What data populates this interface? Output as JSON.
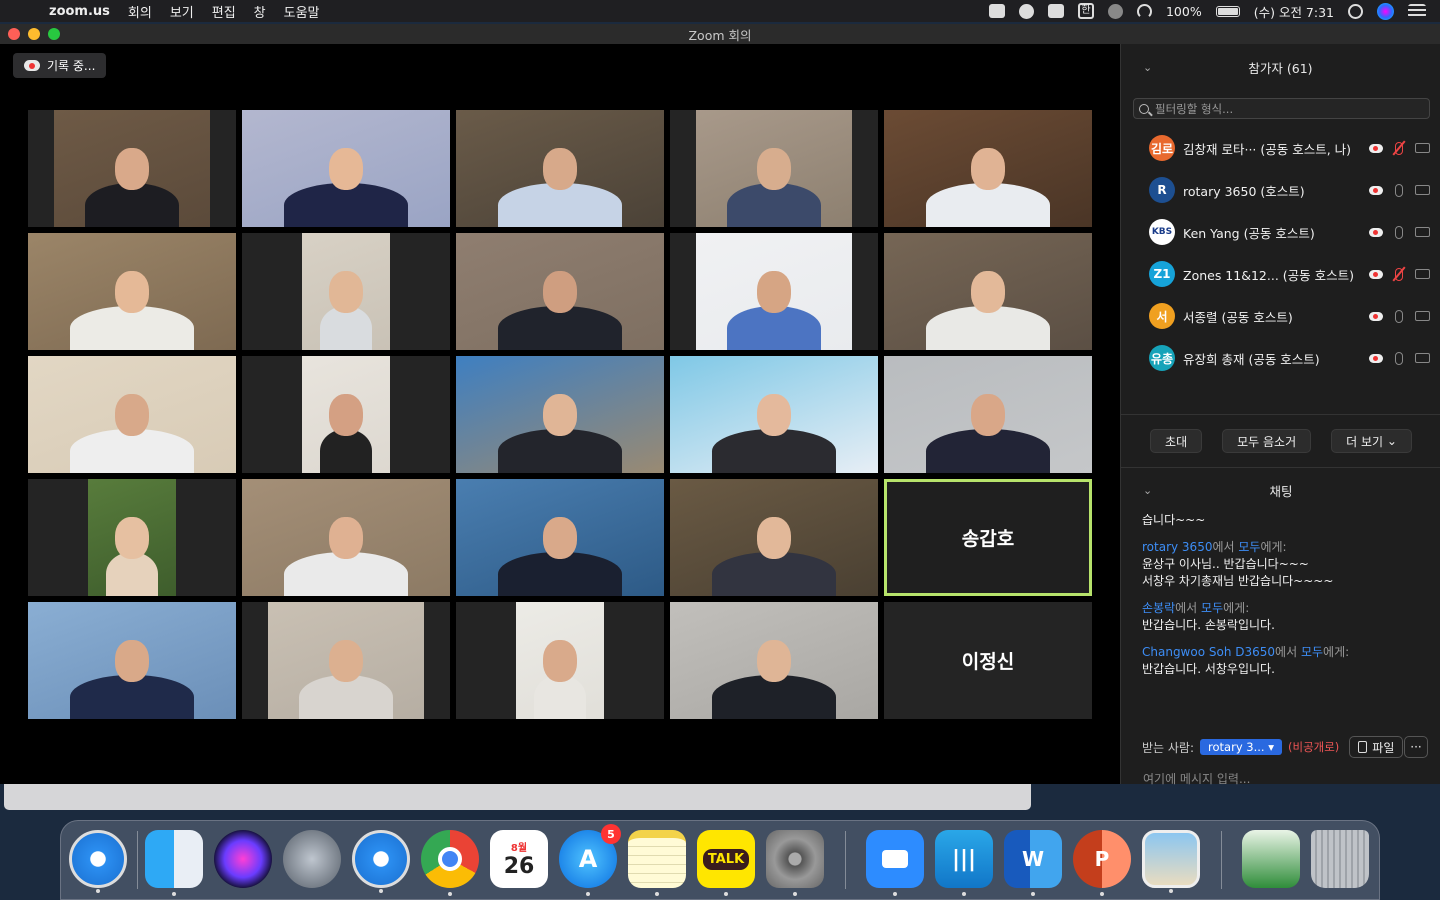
{
  "menubar": {
    "app": "zoom.us",
    "items": [
      "회의",
      "보기",
      "편집",
      "창",
      "도움말"
    ],
    "battery": "100%",
    "clock": "(수) 오전 7:31",
    "input_method": "한"
  },
  "window": {
    "title": "Zoom 회의"
  },
  "recording": {
    "label": "기록 중..."
  },
  "tiles": [
    {
      "bg": "#5b4a3a",
      "vid": "#6e5a46",
      "skin": "#d9a98a",
      "shirt": "#1d1d22"
    },
    {
      "bg": "#9aa4c4",
      "vid": "#b3b7cf",
      "skin": "#e6b896",
      "shirt": "#1f2547"
    },
    {
      "bg": "#4b4237",
      "vid": "#6a5b49",
      "skin": "#d7a98a",
      "shirt": "#c6d3e6"
    },
    {
      "bg": "#8d8070",
      "vid": "#a8998a",
      "skin": "#d7ad8e",
      "shirt": "#3c4a6a"
    },
    {
      "bg": "#4a3526",
      "vid": "#6b4b34",
      "skin": "#e0b394",
      "shirt": "#e9ecf0"
    },
    {
      "bg": "#7e6a52",
      "vid": "#9b8568",
      "skin": "#e5b997",
      "shirt": "#ecebe6"
    },
    {
      "bg": "#c9c2b6",
      "vid": "#d8d1c5",
      "skin": "#e1b796",
      "shirt": "#d9dcdf"
    },
    {
      "bg": "#7e6f61",
      "vid": "#8f7e70",
      "skin": "#cf9e80",
      "shirt": "#20232c"
    },
    {
      "bg": "#e9ebee",
      "vid": "#f0f1f3",
      "skin": "#d6a584",
      "shirt": "#4c74c2"
    },
    {
      "bg": "#5b4f44",
      "vid": "#766655",
      "skin": "#e3b999",
      "shirt": "#e9e9e6"
    },
    {
      "bg": "#d8cbb6",
      "vid": "#e2d7c4",
      "skin": "#d8a98a",
      "shirt": "#eeeeee"
    },
    {
      "bg": "#ddd8d0",
      "vid": "#e8e4dd",
      "skin": "#d4a083",
      "shirt": "#222"
    },
    {
      "bg": "#9a8a72",
      "vid": "#3e7fc1",
      "skin": "#e0b596",
      "shirt": "#23252c"
    },
    {
      "bg": "#e7eef5",
      "vid": "#7fc8e6",
      "skin": "#e4b99c",
      "shirt": "#2b2b30"
    },
    {
      "bg": "#c5c7c9",
      "vid": "#b9bcbf",
      "skin": "#d9a788",
      "shirt": "#222436"
    },
    {
      "bg": "#3e5d2c",
      "vid": "#587c3c",
      "skin": "#e6c0a1",
      "shirt": "#e6d2bc"
    },
    {
      "bg": "#8c7a64",
      "vid": "#a48f77",
      "skin": "#dfb192",
      "shirt": "#eaeaea"
    },
    {
      "bg": "#2d5a86",
      "vid": "#4a7eb0",
      "skin": "#d9a98a",
      "shirt": "#1a2030"
    },
    {
      "bg": "#4a4032",
      "vid": "#6a5a44",
      "skin": "#e2b899",
      "shirt": "#323440"
    },
    {
      "bg": "#1f1f1f",
      "vid": "",
      "skin": "",
      "shirt": ""
    },
    {
      "bg": "#6b8fb8",
      "vid": "#8aaed3",
      "skin": "#d9a989",
      "shirt": "#1f2a4a"
    },
    {
      "bg": "#b6aea3",
      "vid": "#c9c0b3",
      "skin": "#dcb090",
      "shirt": "#d8d4cf"
    },
    {
      "bg": "#e1dfd9",
      "vid": "#ecebe6",
      "skin": "#d9aa8b",
      "shirt": "#e8e6e1"
    },
    {
      "bg": "#a9a7a3",
      "vid": "#c1bfbb",
      "skin": "#dfb596",
      "shirt": "#1e2128"
    },
    {
      "bg": "#242424",
      "vid": "",
      "skin": "",
      "shirt": ""
    }
  ],
  "tile_names": {
    "t19": "송갑호",
    "t24": "이정신"
  },
  "participants": {
    "title": "참가자 (61)",
    "filter_placeholder": "필터링할 형식...",
    "list": [
      {
        "avatar": "김로",
        "avatar_color": "#e8692e",
        "name": "김창재 로타···  (공동 호스트, 나)",
        "mic_muted": true
      },
      {
        "avatar": "R",
        "avatar_color": "#1d4f91",
        "name": "rotary 3650 (호스트)",
        "mic_muted": false
      },
      {
        "avatar": "KBS",
        "avatar_color": "#ffffff",
        "name": "Ken Yang (공동 호스트)",
        "mic_muted": false
      },
      {
        "avatar": "Z1",
        "avatar_color": "#16a3d9",
        "name": "Zones 11&12...  (공동 호스트)",
        "mic_muted": true
      },
      {
        "avatar": "서",
        "avatar_color": "#f0a020",
        "name": "서종렬 (공동 호스트)",
        "mic_muted": false
      },
      {
        "avatar": "유총",
        "avatar_color": "#16a3b9",
        "name": "유장희 총재 (공동 호스트)",
        "mic_muted": false
      }
    ],
    "buttons": {
      "invite": "초대",
      "mute_all": "모두 음소거",
      "more": "더 보기"
    }
  },
  "chat": {
    "title": "채팅",
    "partial_text": "습니다~~~",
    "messages": [
      {
        "from": "rotary 3650",
        "from_suffix": "에서 ",
        "to": "모두",
        "to_suffix": "에게:",
        "lines": [
          "윤상구 이사님.. 반갑습니다~~~",
          "서창우 차기총재님 반갑습니다~~~~"
        ]
      },
      {
        "from": "손봉락",
        "from_suffix": "에서 ",
        "to": "모두",
        "to_suffix": "에게:",
        "lines": [
          "반갑습니다. 손봉락입니다."
        ]
      },
      {
        "from": "Changwoo Soh D3650",
        "from_suffix": "에서 ",
        "to": "모두",
        "to_suffix": "에게:",
        "lines": [
          "반갑습니다. 서창우입니다."
        ]
      }
    ],
    "send_to_label": "받는 사람:",
    "send_to_value": "rotary 3... ▾",
    "private_label": "(비공개로)",
    "file_label": "파일",
    "more_label": "···",
    "input_placeholder": "여기에 메시지 입력..."
  },
  "dock": {
    "calendar_month": "8월",
    "calendar_day": "26",
    "appstore_badge": "5",
    "talk_label": "TALK",
    "word_label": "W",
    "ppt_label": "P"
  }
}
